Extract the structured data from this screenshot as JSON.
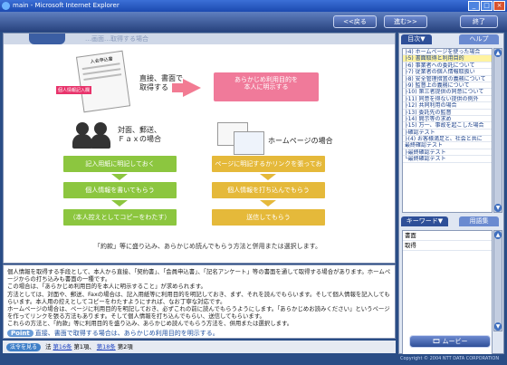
{
  "window": {
    "title": "main - Microsoft Internet Explorer",
    "controls": [
      "_",
      "□",
      "×"
    ]
  },
  "nav": {
    "back": "<<戻る",
    "forward": "進む>>",
    "exit": "終了"
  },
  "content_header": {
    "text": "…画面…取得する場合"
  },
  "diagram": {
    "top_left": "直接、書面で\n取得する",
    "top_right_box": "あらかじめ利用目的を\n本人に明示する",
    "mid_left": "対面、郵送、\nＦａｘの場合",
    "mid_right": "ホームページの場合",
    "left_steps": [
      "記入用紙に明記しておく",
      "個人情報を書いてもらう",
      "（本人控えとしてコピーをわたす）"
    ],
    "right_steps": [
      "ページに明記するかリンクを張っておく",
      "個人情報を打ち込んでもらう",
      "送信してもらう"
    ],
    "caption": "「約款」等に盛り込み、あらかじめ読んでもらう方法と併用または選択します。",
    "form_label": "入会申込書",
    "form_tag": "個人情報記入欄"
  },
  "text_panel": {
    "lines": [
      "個人情報を取得する手段として、本人から直接、「契約書」、「会員申込書」、「記名アンケート」等の書面を通して取得する場合があります。ホームページからの打ち込みも書面の一種です。",
      "この場合は、「あらかじめ利用目的を本人に明示すること」が求められます。",
      "方法としては、対面や、郵送、Faxの場合は、記入用紙等に利用目的を明記しておき、まず、それを読んでもらいます。そして個人情報を記入してもらいます。本人用の控えとしてコピーをわたすようにすれば、なお丁寧な対応です。",
      "ホームページの場合は、ページに利用目的を明記しておき、必ずこれの前に読んでもらうようにします。「あらかじめお読みください」というページを作ってリンクを張る方法もあります。そして個人情報を打ち込んでもらい、送信してもらいます。",
      "これらの方法と、「約款」等に利用目的を盛り込み、あらかじめ読んでもらう方法を、併用または選択します。"
    ],
    "point_label": "Point",
    "point_text": "直接、書面で取得する場合は、あらかじめ利用目的を明示する。"
  },
  "bottom_bar": {
    "tag": "法令を見る",
    "prefix": "法",
    "link1": "第16条",
    "mid1": "第1項、",
    "link2": "第18条",
    "mid2": "第2項"
  },
  "right_panel": {
    "toc_tab": "目次▼",
    "help_tab": "ヘルプ",
    "toc_items": [
      "├4) ホームページを使った場合",
      "├5) 書面取得と利用目的",
      "├6) 事業者への委託について",
      "├7) 従業者の個人情報取扱い",
      "├8) 安全管理措置の義務について",
      "├9) 監督上の義務について",
      "├10) 第三者提供の同意について",
      "├11) 同意を得ない提供の例外",
      "├12) 共同利用の場合",
      "├13) 委託先の監督",
      "├14) 開示等の求め",
      "├15) 万一、事故を起こした場合",
      "├確認テスト",
      "├(4) お客様満足と、社会と共に",
      "最終確認テスト",
      "├最終確認テスト",
      "└最終確認テスト"
    ],
    "keyword_tab": "キーワード▼",
    "glossary_tab": "用語集",
    "keywords": [
      "書面",
      "取得"
    ],
    "movie_button": "ムービー",
    "copyright": "Copyright © 2004 NTT DATA CORPORATION"
  },
  "colors": {
    "accent_pink": "#f07a9a",
    "accent_green": "#8cc63f",
    "accent_yellow": "#e5b93a",
    "frame_blue": "#2a4d86"
  }
}
